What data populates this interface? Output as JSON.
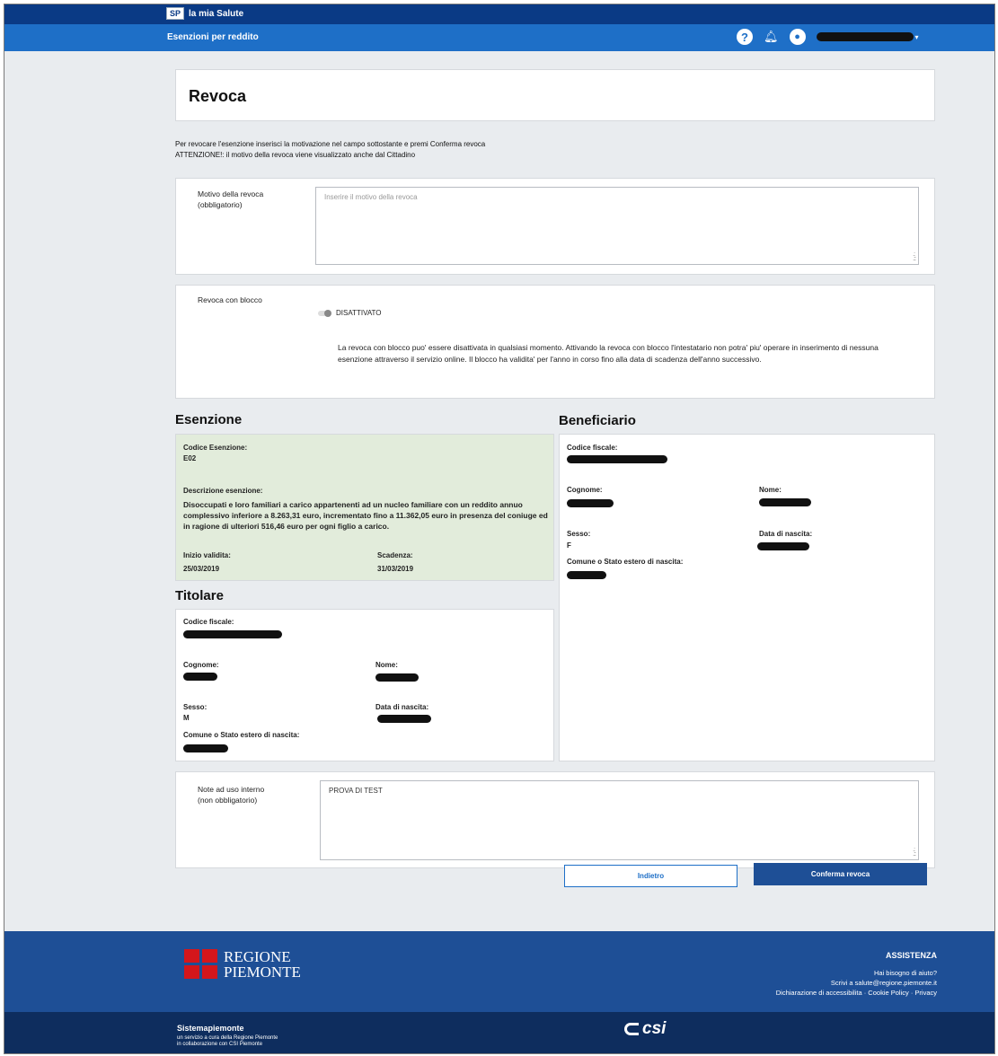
{
  "header": {
    "brand_badge": "SP",
    "brand_name": "la mia Salute",
    "service_name": "Esenzioni per reddito",
    "help_icon": "question-circle-icon",
    "bell_icon": "bell-icon",
    "user_icon": "user-circle-icon"
  },
  "page": {
    "title": "Revoca",
    "intro_line1": "Per revocare l'esenzione inserisci la motivazione nel campo sottostante e premi Conferma revoca",
    "intro_line2": "ATTENZIONE!: il motivo della revoca viene visualizzato anche dal Cittadino"
  },
  "revoca_form": {
    "reason_label_1": "Motivo della revoca",
    "reason_label_2": "(obbligatorio)",
    "reason_placeholder": "Inserire il motivo della revoca",
    "block_label": "Revoca con blocco",
    "block_toggle_state": "DISATTIVATO",
    "block_description": "La revoca con blocco puo' essere disattivata in qualsiasi momento. Attivando la revoca con blocco l'intestatario non potra' piu' operare in inserimento di nessuna esenzione attraverso il servizio online. Il blocco ha validita' per l'anno in corso fino alla data di scadenza dell'anno successivo."
  },
  "esenzione": {
    "heading": "Esenzione",
    "code_label": "Codice Esenzione:",
    "code_value": "E02",
    "desc_label": "Descrizione esenzione:",
    "desc_value": "Disoccupati e loro familiari a carico appartenenti ad un nucleo familiare con un reddito annuo complessivo inferiore a 8.263,31 euro, incrementato fino a 11.362,05 euro in presenza del coniuge ed in ragione di ulteriori 516,46 euro per ogni figlio a carico.",
    "start_label": "Inizio validita:",
    "start_value": "25/03/2019",
    "end_label": "Scadenza:",
    "end_value": "31/03/2019"
  },
  "titolare": {
    "heading": "Titolare",
    "cf_label": "Codice fiscale:",
    "surname_label": "Cognome:",
    "name_label": "Nome:",
    "sex_label": "Sesso:",
    "sex_value": "M",
    "birthdate_label": "Data di nascita:",
    "birthplace_label": "Comune o Stato estero di nascita:"
  },
  "beneficiario": {
    "heading": "Beneficiario",
    "cf_label": "Codice fiscale:",
    "surname_label": "Cognome:",
    "name_label": "Nome:",
    "sex_label": "Sesso:",
    "sex_value": "F",
    "birthdate_label": "Data di nascita:",
    "birthplace_label": "Comune o Stato estero di nascita:"
  },
  "note_form": {
    "label_1": "Note ad uso interno",
    "label_2": "(non obbligatorio)",
    "value": "PROVA DI TEST"
  },
  "actions": {
    "back_label": "Indietro",
    "confirm_label": "Conferma revoca"
  },
  "footer": {
    "logo_line1": "REGIONE",
    "logo_line2": "PIEMONTE",
    "assist_heading": "ASSISTENZA",
    "assist_line1": "Hai bisogno di aiuto?",
    "assist_line2": "Scrivi a salute@regione.piemonte.it",
    "assist_line3": "Dichiarazione di accessibilita · Cookie Policy · Privacy",
    "bottom_line1": "Sistemapiemonte",
    "bottom_line2": "un servizio a cura della Regione Piemonte",
    "bottom_line3": "in collaborazione con CSI Piemonte",
    "csi_text": "csi"
  }
}
